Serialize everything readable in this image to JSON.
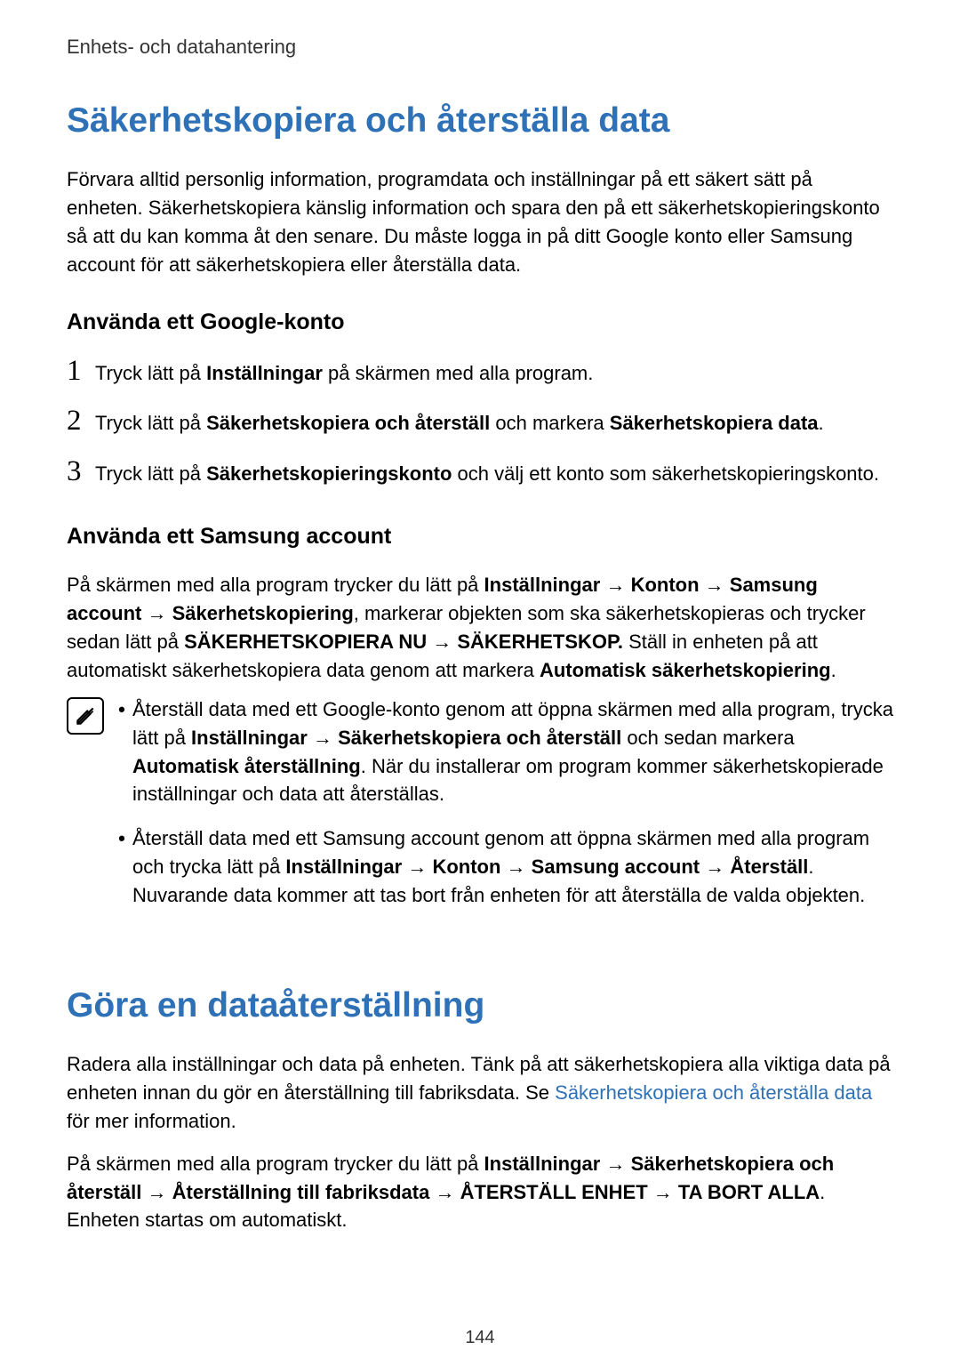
{
  "breadcrumb": "Enhets- och datahantering",
  "heading1": "Säkerhetskopiera och återställa data",
  "intro1": "Förvara alltid personlig information, programdata och inställningar på ett säkert sätt på enheten. Säkerhetskopiera känslig information och spara den på ett säkerhetskopieringskonto så att du kan komma åt den senare. Du måste logga in på ditt Google konto eller Samsung account för att säkerhetskopiera eller återställa data.",
  "sub1": "Använda ett Google-konto",
  "steps": [
    {
      "n": "1",
      "pre": "Tryck lätt på ",
      "b1": "Inställningar",
      "post": " på skärmen med alla program."
    },
    {
      "n": "2",
      "pre": "Tryck lätt på ",
      "b1": "Säkerhetskopiera och återställ",
      "mid": " och markera ",
      "b2": "Säkerhetskopiera data",
      "post": "."
    },
    {
      "n": "3",
      "pre": "Tryck lätt på ",
      "b1": "Säkerhetskopieringskonto",
      "post": " och välj ett konto som säkerhetskopieringskonto."
    }
  ],
  "sub2": "Använda ett Samsung account",
  "samsung_p": {
    "t1": "På skärmen med alla program trycker du lätt på ",
    "b1": "Inställningar",
    "arr": " → ",
    "b2": "Konton",
    "b3": "Samsung account",
    "b4": "Säkerhetskopiering",
    "t2": ", markerar objekten som ska säkerhetskopieras och trycker sedan lätt på ",
    "b5": "SÄKERHETSKOPIERA NU",
    "b6": "SÄKERHETSKOP.",
    "t3": " Ställ in enheten på att automatiskt säkerhetskopiera data genom att markera ",
    "b7": "Automatisk säkerhetskopiering",
    "t4": "."
  },
  "note1": {
    "t1": "Återställ data med ett Google-konto genom att öppna skärmen med alla program, trycka lätt på ",
    "b1": "Inställningar",
    "arr": " → ",
    "b2": "Säkerhetskopiera och återställ",
    "t2": " och sedan markera ",
    "b3": "Automatisk återställning",
    "t3": ". När du installerar om program kommer säkerhetskopierade inställningar och data att återställas."
  },
  "note2": {
    "t1": "Återställ data med ett Samsung account genom att öppna skärmen med alla program och trycka lätt på ",
    "b1": "Inställningar",
    "arr": " → ",
    "b2": "Konton",
    "b3": "Samsung account",
    "b4": "Återställ",
    "t2": ". Nuvarande data kommer att tas bort från enheten för att återställa de valda objekten."
  },
  "heading2": "Göra en dataåterställning",
  "reset_p1": {
    "t1": "Radera alla inställningar och data på enheten. Tänk på att säkerhetskopiera alla viktiga data på enheten innan du gör en återställning till fabriksdata. Se ",
    "link": "Säkerhetskopiera och återställa data",
    "t2": " för mer information."
  },
  "reset_p2": {
    "t1": "På skärmen med alla program trycker du lätt på ",
    "b1": "Inställningar",
    "arr": " → ",
    "b2": "Säkerhetskopiera och återställ",
    "b3": "Återställning till fabriksdata",
    "b4": "ÅTERSTÄLL ENHET",
    "b5": "TA BORT ALLA",
    "t2": ". Enheten startas om automatiskt."
  },
  "page_number": "144",
  "bullet": "•"
}
